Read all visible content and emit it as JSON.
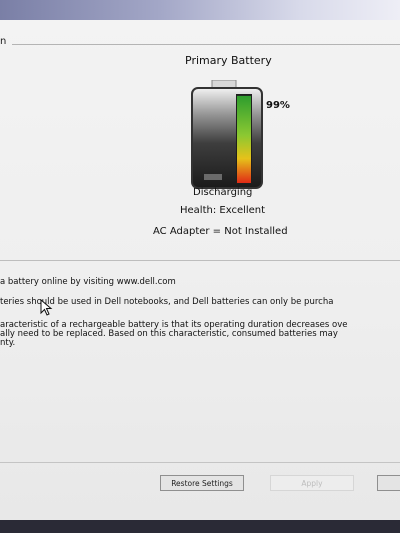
{
  "window": {
    "section_heading": "n"
  },
  "battery": {
    "title": "Primary Battery",
    "charge_percent": "99%",
    "charge_level": 0.99,
    "status": "Discharging",
    "health": "Health: Excellent",
    "ac_adapter": "AC Adapter = Not Installed"
  },
  "info": {
    "line_1": "a battery online by visiting www.dell.com",
    "line_2": "teries should be used in Dell notebooks, and Dell batteries can only be purcha",
    "line_3": "aracteristic of a rechargeable battery is that its operating duration decreases ove",
    "line_4": "ally need to be replaced.  Based on this characteristic, consumed batteries may",
    "line_5": "nty."
  },
  "buttons": {
    "restore_settings": "Restore Settings",
    "faded_button": "Apply"
  },
  "colors": {
    "charge_gradient_top": "#2e9d2e",
    "charge_gradient_mid": "#e6c21a",
    "charge_gradient_bottom": "#e02a16"
  }
}
